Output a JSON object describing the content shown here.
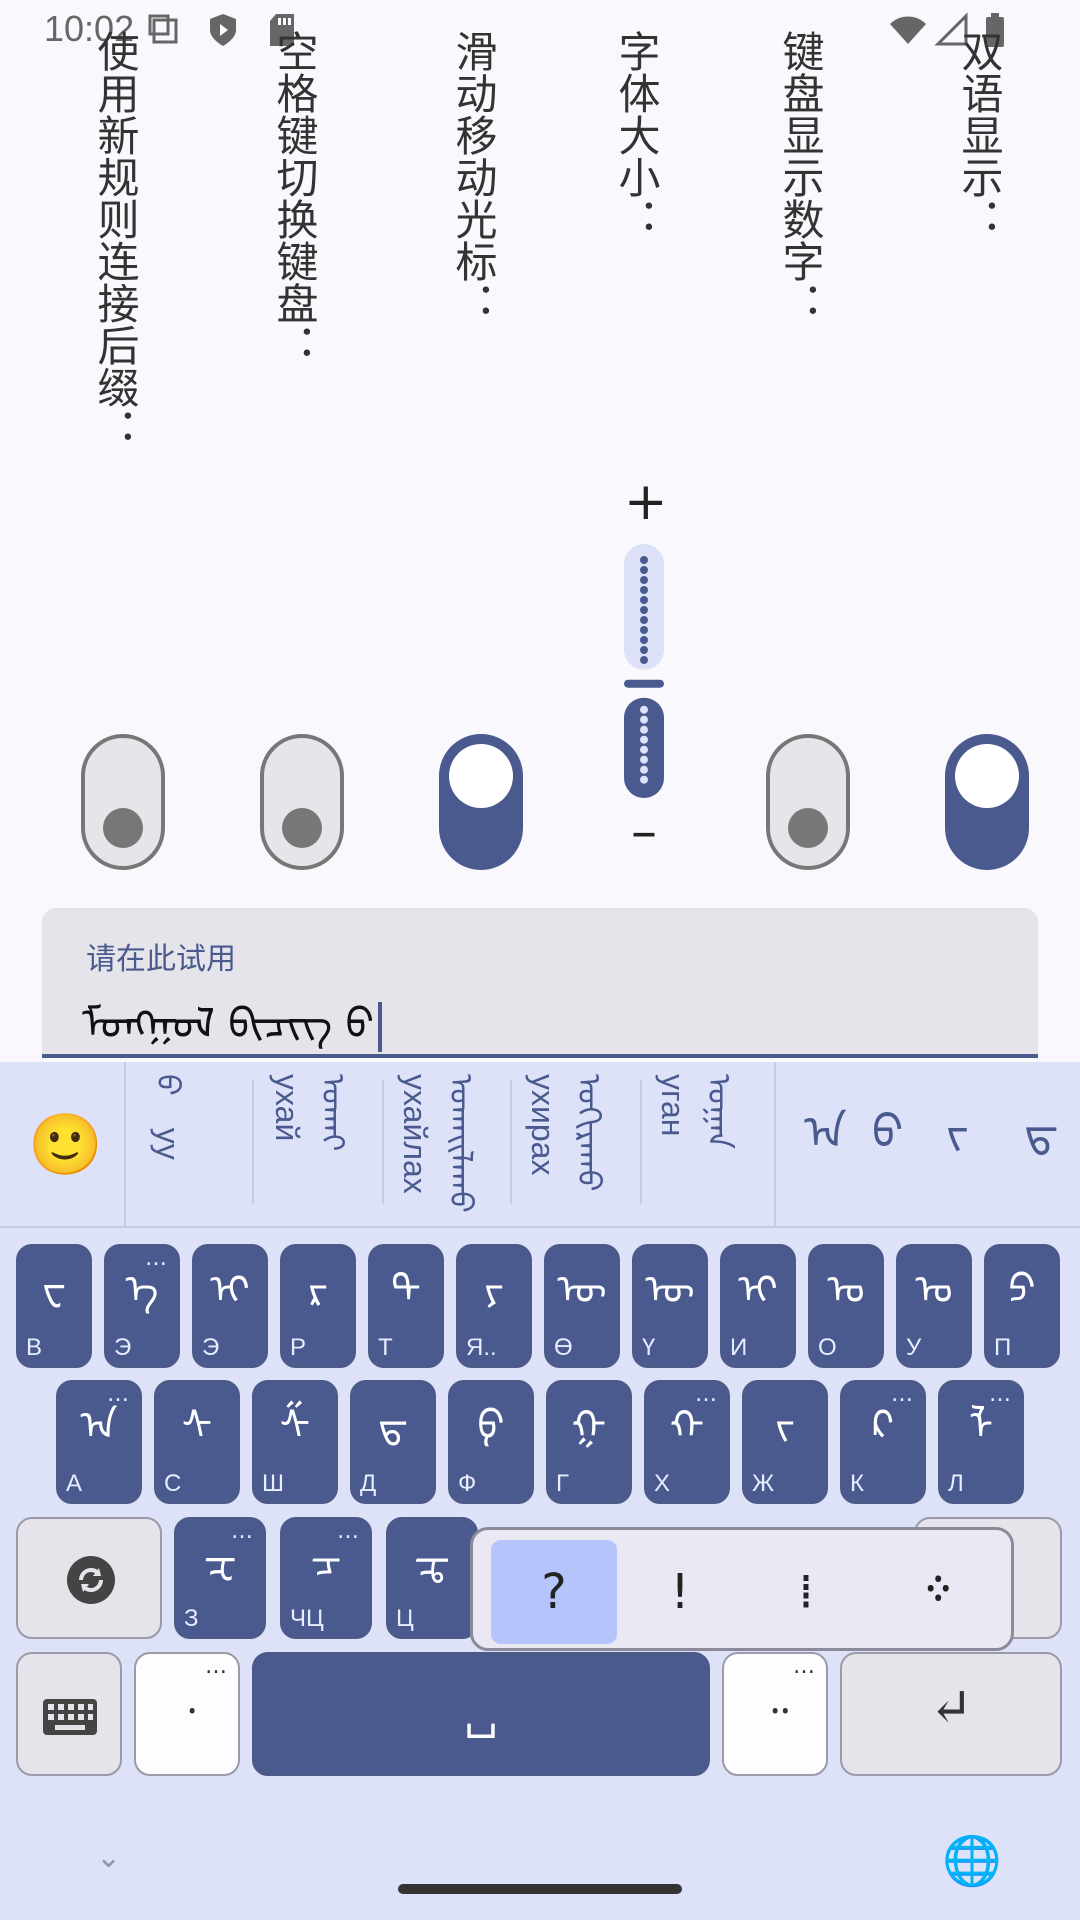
{
  "status_bar": {
    "time": "10:02"
  },
  "settings": [
    {
      "label": "使用新规则连接后缀：",
      "enabled": false
    },
    {
      "label": "空格键切换键盘：",
      "enabled": false
    },
    {
      "label": "滑动移动光标：",
      "enabled": true
    },
    {
      "label": "字体大小：",
      "plus": "+",
      "minus": "–",
      "level": 0.45
    },
    {
      "label": "键盘显示数字：",
      "enabled": false
    },
    {
      "label": "双语显示：",
      "enabled": true
    }
  ],
  "test_input": {
    "label": "请在此试用",
    "value": "ᠮᠣᠩᠭᠣᠯ ᠪᠢᠴᠢᠭ ᠪ"
  },
  "suggestions": {
    "emoji": "🙂",
    "words": [
      {
        "mongol": "ᠪ",
        "cyrillic": "уу"
      },
      {
        "mongol": "ᠤᠬᠠᠢ",
        "cyrillic": "ухай"
      },
      {
        "mongol": "ᠤᠬᠠᠢᠯᠠᠬᠤ",
        "cyrillic": "ухайлах"
      },
      {
        "mongol": "ᠤᠬᠢᠷᠠᠬᠤ",
        "cyrillic": "ухирах"
      },
      {
        "mongol": "ᠤᠭᠠᠨ",
        "cyrillic": "уган"
      }
    ],
    "glyphs": [
      "ᠠ",
      "ᠪ",
      "ᠵ",
      "ᠳ"
    ]
  },
  "keys": {
    "row1": [
      {
        "g": "ᠸ",
        "s": "В"
      },
      {
        "g": "ᠡ",
        "s": "Э",
        "more": true
      },
      {
        "g": "ᠢ",
        "s": "Э"
      },
      {
        "g": "ᠷ",
        "s": "Р"
      },
      {
        "g": "ᠲ",
        "s": "Т"
      },
      {
        "g": "ᠶ",
        "s": "Я.."
      },
      {
        "g": "ᠥ",
        "s": "Ө"
      },
      {
        "g": "ᠦ",
        "s": "Ү"
      },
      {
        "g": "ᠢ",
        "s": "И"
      },
      {
        "g": "ᠣ",
        "s": "О"
      },
      {
        "g": "ᠤ",
        "s": "У"
      },
      {
        "g": "ᠫ",
        "s": "П"
      }
    ],
    "row2": [
      {
        "g": "ᠠ",
        "s": "А",
        "more": true
      },
      {
        "g": "ᠰ",
        "s": "С"
      },
      {
        "g": "ᠱ",
        "s": "Ш"
      },
      {
        "g": "ᠳ",
        "s": "Д"
      },
      {
        "g": "ᠹ",
        "s": "Ф"
      },
      {
        "g": "ᠭ",
        "s": "Г"
      },
      {
        "g": "ᠬ",
        "s": "Х",
        "more": true
      },
      {
        "g": "ᠵ",
        "s": "Ж"
      },
      {
        "g": "ᠺ",
        "s": "К",
        "more": true
      },
      {
        "g": "ᠯ",
        "s": "Л",
        "more": true
      }
    ],
    "row3": [
      {
        "g": "ᠽ",
        "s": "З",
        "more": true
      },
      {
        "g": "ᠴ",
        "s": "ЧЦ",
        "more": true
      },
      {
        "g": "ᠼ",
        "s": "Ц"
      }
    ],
    "switch_icon": "refresh-icon",
    "keyboard_icon": "keyboard-icon",
    "comma": "᠂",
    "period": "᠃",
    "space": "␣",
    "enter": "↵"
  },
  "punct_popup": [
    "?",
    "!",
    "⁞",
    "᠅"
  ],
  "nav": {
    "down": "⌄",
    "globe": "🌐"
  }
}
